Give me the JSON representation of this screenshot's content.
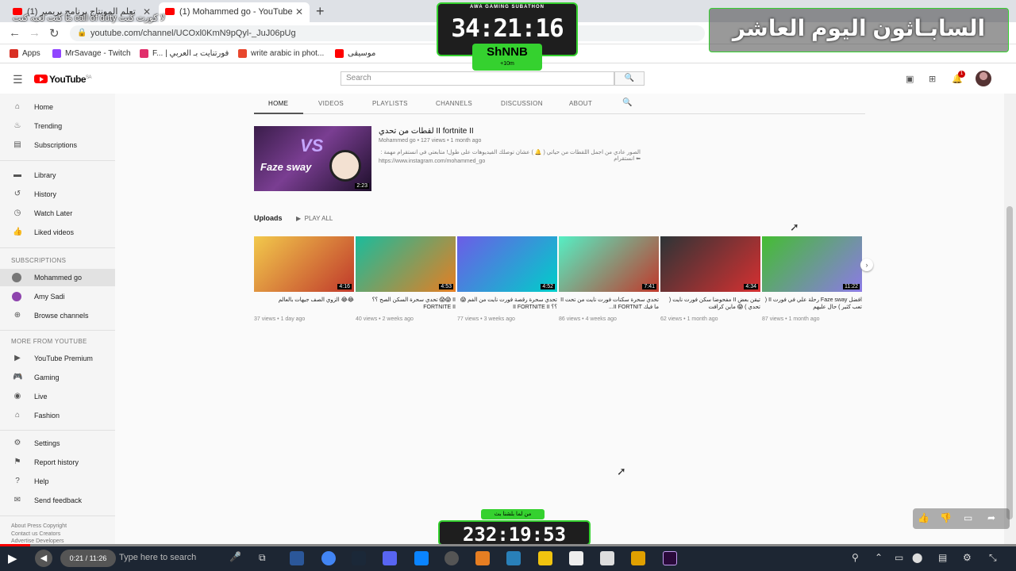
{
  "browser": {
    "tabs": [
      {
        "label": "(1) تعلم المونتاج برنامج بريمير",
        "active": false
      },
      {
        "label": "(1) Mohammed go - YouTube",
        "active": true
      }
    ],
    "new_tab": "+",
    "url": "youtube.com/channel/UCOxl0KmN9pQyl-_JuJ06pUg",
    "bookmarks": [
      {
        "label": "Apps",
        "color": "#d93025"
      },
      {
        "label": "MrSavage - Twitch",
        "color": "#9146ff"
      },
      {
        "label": "F... | فورتنايت بـ العربي",
        "color": "#e1306c"
      },
      {
        "label": "write arabic in phot...",
        "color": "#e8472d"
      },
      {
        "label": "موسيقى",
        "color": "#ff0000"
      }
    ]
  },
  "youtube": {
    "logo": "YouTube",
    "logo_sup": "SA",
    "search_placeholder": "Search",
    "sidebar": {
      "main": [
        "Home",
        "Trending",
        "Subscriptions"
      ],
      "library": [
        "Library",
        "History",
        "Watch Later",
        "Liked videos"
      ],
      "subscriptions_header": "SUBSCRIPTIONS",
      "subscriptions": [
        "Mohammed go",
        "Amy Sadi",
        "Browse channels"
      ],
      "more_header": "MORE FROM YOUTUBE",
      "more": [
        "YouTube Premium",
        "Gaming",
        "Live",
        "Fashion"
      ],
      "settings": [
        "Settings",
        "Report history",
        "Help",
        "Send feedback"
      ],
      "footer1": "About  Press  Copyright",
      "footer2": "Contact us  Creators",
      "footer3": "Advertise  Developers"
    },
    "channel_tabs": [
      "HOME",
      "VIDEOS",
      "PLAYLISTS",
      "CHANNELS",
      "DISCUSSION",
      "ABOUT"
    ],
    "featured": {
      "thumb_text_vs": "VS",
      "thumb_text_name": "Faze sway",
      "duration": "2:23",
      "title": "لقطات من تحدي II fortnite II",
      "meta": "Mohammed go • 127 views • 1 month ago",
      "desc": "الصور عادي من اجمل اللقطات من حياتي ( 🔔 ) عشان توصلك الفيديوهات على طول! متابعتي في انستقرام مهمة : ⬅ انستقرام",
      "link": "https://www.instagram.com/mohammed_go"
    },
    "uploads_header": "Uploads",
    "play_all": "PLAY ALL",
    "videos": [
      {
        "title": "😂😂 الزوي الصف جيهات بالعالم",
        "meta": "37 views • 1 day ago",
        "duration": "4:16",
        "c1": "#f2c94c",
        "c2": "#c0392b"
      },
      {
        "title": "II 😱😱 تحدي سحرة السكن الصح ؟؟ FORTNITE II",
        "meta": "40 views • 2 weeks ago",
        "duration": "4:53",
        "c1": "#1abc9c",
        "c2": "#e67e22"
      },
      {
        "title": "تحدي سحرة رقصة فورت نايت من الفم 😱 ؟؟ II FORTNITE II",
        "meta": "77 views • 3 weeks ago",
        "duration": "4:52",
        "c1": "#6c5ce7",
        "c2": "#00cec9"
      },
      {
        "title": "تحدي سحرة سكنات فورت نايت من تحت II ما فيك II FORTNIT...",
        "meta": "86 views • 4 weeks ago",
        "duration": "7:41",
        "c1": "#55efc4",
        "c2": "#c0392b"
      },
      {
        "title": "تيقن بعض II مفحوضا سكن فورت نايت ( تحدي ) 😱 ماين كرافت",
        "meta": "62 views • 1 month ago",
        "duration": "4:34",
        "c1": "#2d3436",
        "c2": "#d63031"
      },
      {
        "title": "افضل Faze sway رحلة علي في فورت II ( تعب كثير ) حال عليهم",
        "meta": "87 views • 1 month ago",
        "duration": "11:22",
        "c1": "#44bd32",
        "c2": "#8c7ae6"
      }
    ]
  },
  "overlay": {
    "top_label": "AWA GAMING SUBATHON",
    "timer": "34:21:16",
    "streamer": "ShNNB",
    "streamer_sub": "+10m",
    "arabic_title": "السابـاثون اليوم العاشر",
    "top_left_text": "لا كورت كنت call of duty ما كنت لعبه كنت",
    "bottom_label": "من لما بلشنا بث",
    "bottom_timer": "232:19:53"
  },
  "player": {
    "time": "0:21 / 11:26",
    "progress": 0.03,
    "search_text": "Type here to search"
  }
}
